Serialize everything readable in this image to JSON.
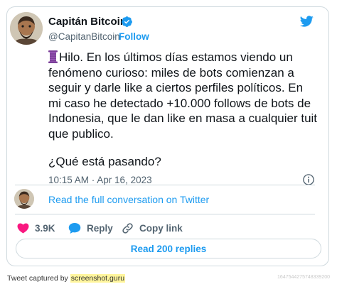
{
  "tweet": {
    "author_name": "Capitán Bitcoin",
    "author_handle": "@CapitanBitcoin",
    "separator": "·",
    "follow_label": "Follow",
    "body_main": "Hilo. En los últimos días estamos viendo un fenómeno curioso: miles de bots comienzan a seguir y darle like a ciertos perfiles políticos. En mi caso he detectado +10.000 follows de bots de Indonesia, que le dan like en masa a cualquier tuit que publico.",
    "body_question": "¿Qué está pasando?",
    "timestamp": "10:15 AM · Apr 16, 2023",
    "read_conversation_label": "Read the full conversation on Twitter",
    "likes_count": "3.9K",
    "reply_label": "Reply",
    "copy_link_label": "Copy link",
    "read_replies_label": "Read 200 replies"
  },
  "footer": {
    "captured_prefix": "Tweet captured by",
    "captured_site": "screenshot.guru",
    "capture_id": "1647544275748339200"
  },
  "icons": {
    "verified": "verified-badge-icon",
    "twitter": "twitter-bird-icon",
    "info": "info-icon",
    "thread": "thread-spool-icon",
    "like": "heart-icon",
    "reply": "speech-bubble-icon",
    "copy_link": "link-icon"
  },
  "colors": {
    "accent": "#1d9bf0",
    "like": "#f91880",
    "text": "#0f1419",
    "secondary": "#536471",
    "border": "#cfd9de",
    "thread_icon": "#7b3f99"
  }
}
